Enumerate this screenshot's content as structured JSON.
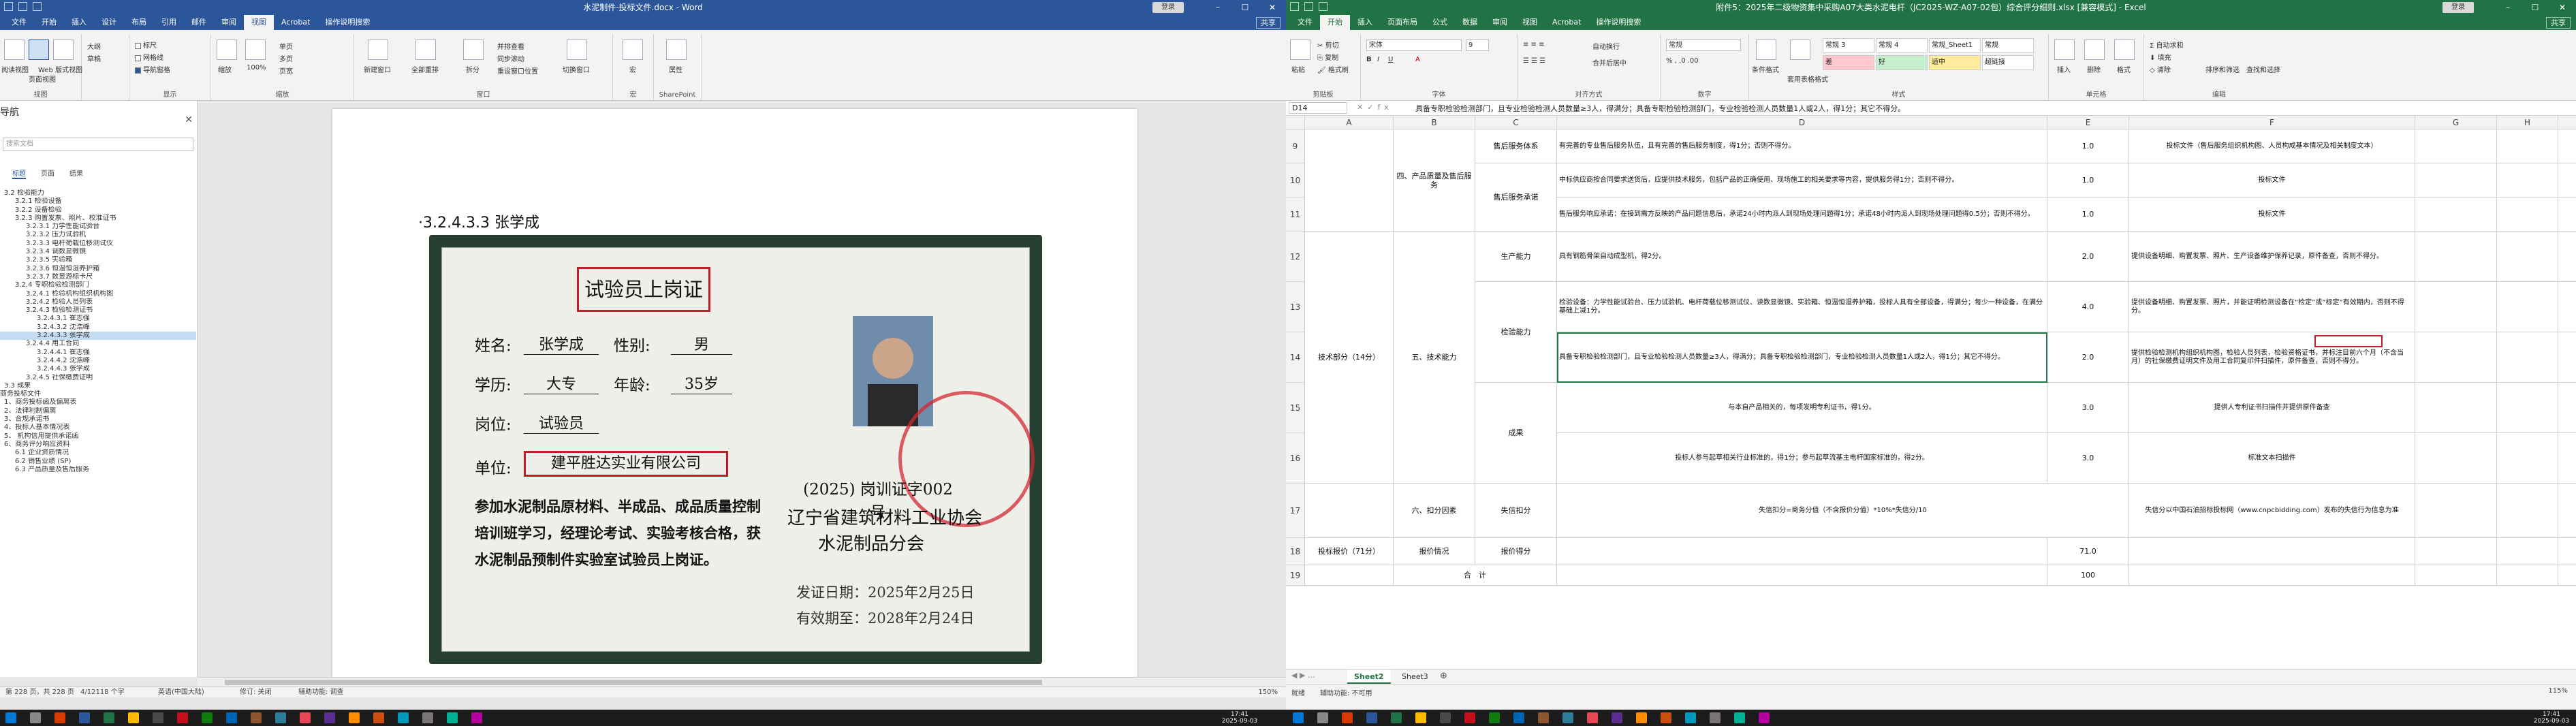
{
  "word": {
    "title": "水泥制件-投标文件.docx - Word",
    "signin": "登录",
    "tabs": [
      "文件",
      "开始",
      "插入",
      "设计",
      "布局",
      "引用",
      "邮件",
      "审阅",
      "视图",
      "Acrobat",
      "操作说明搜索"
    ],
    "share": "共享",
    "ribbon": {
      "views": {
        "read": "阅读视图",
        "print": "页面视图",
        "web": "Web 版式视图",
        "label": "视图"
      },
      "outline": "大纲",
      "draft": "草稿",
      "show": {
        "ruler": "标尺",
        "gridlines": "网格线",
        "navpane": "导航窗格",
        "label": "显示"
      },
      "zoom": {
        "zoom": "缩放",
        "pct": "100%",
        "onepage": "单页",
        "multipage": "多页",
        "pagewidth": "页宽",
        "label": "缩放"
      },
      "window": {
        "newwin": "新建窗口",
        "arrange": "全部重排",
        "split": "拆分",
        "side": "并排查看",
        "sync": "同步滚动",
        "reset": "重设窗口位置",
        "switch": "切换窗口",
        "label": "窗口"
      },
      "macro": {
        "macro": "宏",
        "label": "宏"
      },
      "sharepoint": {
        "props": "属性",
        "label": "SharePoint"
      }
    },
    "nav": {
      "title": "导航",
      "search_placeholder": "搜索文档",
      "tabs": [
        "标题",
        "页面",
        "结果"
      ],
      "items": [
        {
          "t": "3.2 检验能力",
          "l": 1
        },
        {
          "t": "3.2.1 检验设备",
          "l": 2
        },
        {
          "t": "3.2.2 设备检验",
          "l": 2
        },
        {
          "t": "3.2.3 购置发票、照片、校准证书",
          "l": 2
        },
        {
          "t": "3.2.3.1 力学性能试验台",
          "l": 3
        },
        {
          "t": "3.2.3.2 压力试验机",
          "l": 3
        },
        {
          "t": "3.2.3.3 电杆荷载位移测试仪",
          "l": 3
        },
        {
          "t": "3.2.3.4 调数显微镜",
          "l": 3
        },
        {
          "t": "3.2.3.5 实验箱",
          "l": 3
        },
        {
          "t": "3.2.3.6 恒温恒湿养护箱",
          "l": 3
        },
        {
          "t": "3.2.3.7 数显游标卡尺",
          "l": 3
        },
        {
          "t": "3.2.4 专职检验检测部门",
          "l": 2
        },
        {
          "t": "3.2.4.1 检验机构组织机构图",
          "l": 3
        },
        {
          "t": "3.2.4.2 检验人员列表",
          "l": 3
        },
        {
          "t": "3.2.4.3 检验检测证书",
          "l": 3
        },
        {
          "t": "3.2.4.3.1 崔志强",
          "l": 4
        },
        {
          "t": "3.2.4.3.2 沈浩峰",
          "l": 4
        },
        {
          "t": "3.2.4.3.3 张学成",
          "l": 4,
          "active": true
        },
        {
          "t": "3.2.4.4 用工合同",
          "l": 3
        },
        {
          "t": "3.2.4.4.1 崔志强",
          "l": 4
        },
        {
          "t": "3.2.4.4.2 沈浩峰",
          "l": 4
        },
        {
          "t": "3.2.4.4.3 张学成",
          "l": 4
        },
        {
          "t": "3.2.4.5 社保缴费证明",
          "l": 3
        },
        {
          "t": "3.3 成果",
          "l": 1
        },
        {
          "t": "商务投标文件",
          "l": 0
        },
        {
          "t": "1、商务投标函及偏离表",
          "l": 1
        },
        {
          "t": "2、法律利制偏离",
          "l": 1
        },
        {
          "t": "3、合规承诺书",
          "l": 1
        },
        {
          "t": "4、投标人基本情况表",
          "l": 1
        },
        {
          "t": "5、 机构信用提供承诺函",
          "l": 1
        },
        {
          "t": "6、商务评分响应资料",
          "l": 1
        },
        {
          "t": "6.1 企业资质情况",
          "l": 2
        },
        {
          "t": "6.2 销售业绩 (SP)",
          "l": 2
        },
        {
          "t": "6.3 产品质量及售后服务",
          "l": 2
        }
      ]
    },
    "doc": {
      "heading": "·3.2.4.3.3 张学成",
      "cert": {
        "title": "试验员上岗证",
        "name_lbl": "姓名:",
        "name": "张学成",
        "sex_lbl": "性别:",
        "sex": "男",
        "edu_lbl": "学历:",
        "edu": "大专",
        "age_lbl": "年龄:",
        "age": "35岁",
        "post_lbl": "岗位:",
        "post": "试验员",
        "unit_lbl": "单位:",
        "unit": "建平胜达实业有限公司",
        "para": "参加水泥制品原材料、半成品、成品质量控制培训班学习，经理论考试、实验考核合格，获水泥制品预制件实验室试验员上岗证。",
        "certno": "(2025) 岗训证字002号",
        "issuer1": "辽宁省建筑材料工业协会",
        "issuer2": "水泥制品分会",
        "issue_date": "发证日期：2025年2月25日",
        "valid_date": "有效期至：2028年2月24日"
      }
    },
    "status": {
      "page": "第 228 页，共 228 页",
      "words": "4/12118 个字",
      "lang": "英语(中国大陆)",
      "track": "修订: 关闭",
      "access": "辅助功能: 调查",
      "zoom": "150%"
    }
  },
  "excel": {
    "title": "附件5：2025年二级物资集中采购A07大类水泥电杆（JC2025-WZ-A07-02包）综合评分细则.xlsx [兼容模式] - Excel",
    "signin": "登录",
    "tabs": [
      "文件",
      "开始",
      "插入",
      "页面布局",
      "公式",
      "数据",
      "审阅",
      "视图",
      "Acrobat",
      "操作说明搜索"
    ],
    "share": "共享",
    "ribbon": {
      "clipboard": "剪贴板",
      "paste": "粘贴",
      "cut": "剪切",
      "copy": "复制",
      "painter": "格式刷",
      "font_name": "宋体",
      "font_size": "9",
      "font": "字体",
      "align": "对齐方式",
      "wrap": "自动换行",
      "merge": "合并后居中",
      "number": "数字",
      "numfmt": "常规",
      "cond": "条件格式",
      "table": "套用表格格式",
      "styles": [
        {
          "t": "常规 3",
          "bg": "#ffffff"
        },
        {
          "t": "常规 4",
          "bg": "#ffffff"
        },
        {
          "t": "常规_Sheet1",
          "bg": "#ffffff"
        },
        {
          "t": "常规",
          "bg": "#ffffff"
        },
        {
          "t": "差",
          "bg": "#ffc7ce"
        },
        {
          "t": "好",
          "bg": "#c6efce"
        },
        {
          "t": "适中",
          "bg": "#ffeb9c"
        },
        {
          "t": "超链接",
          "bg": "#ffffff"
        }
      ],
      "styles_lbl": "样式",
      "cells": "单元格",
      "insert": "插入",
      "delete": "删除",
      "format": "格式",
      "editing": "编辑",
      "autosum": "自动求和",
      "fill": "填充",
      "clear": "清除",
      "sortfilter": "排序和筛选",
      "findsel": "查找和选择"
    },
    "namebox": "D14",
    "formula": "具备专职检验检测部门，且专业检验检测人员数量≥3人，得满分；具备专职检验检测部门，专业检验检测人员数量1人或2人，得1分；其它不得分。",
    "cols": [
      "A",
      "B",
      "C",
      "D",
      "E",
      "F",
      "G",
      "H",
      "I",
      "J"
    ],
    "rows": {
      "r9": {
        "c": "售后服务体系",
        "d": "有完善的专业售后服务队伍，且有完善的售后服务制度，得1分；否则不得分。",
        "e": "1.0",
        "f": "投标文件（售后服务组织机构图、人员构成基本情况及相关制度文本）"
      },
      "r10": {
        "c": "售后服务承诺",
        "d": "中标供应商按合同要求送货后，应提供技术服务，包括产品的正确使用、现场施工的相关要求等内容，提供服务得1分；否则不得分。",
        "e": "1.0",
        "f": "投标文件"
      },
      "r11": {
        "d": "售后服务响应承诺：在接到需方反映的产品问题信息后，承诺24小时内派人到现场处理问题得1分；承诺48小时内派人到现场处理问题得0.5分；否则不得分。",
        "e": "1.0",
        "f": "投标文件"
      },
      "b9": "四、产品质量及售后服务",
      "r12": {
        "c": "生产能力",
        "d": "具有钢筋骨架自动成型机，得2分。",
        "e": "2.0",
        "f": "提供设备明细、购置发票、照片、生产设备维护保养记录，原件备查，否则不得分。"
      },
      "r13": {
        "d": "检验设备：力学性能试验台、压力试验机、电杆荷载位移测试仪、读数显微镜、实验箱、恒温恒湿养护箱，投标人具有全部设备，得满分；每少一种设备，在满分基础上减1分。",
        "e": "4.0",
        "f": "提供设备明细、购置发票、照片，并能证明检测设备在“检定”或“标定”有效期内，否则不得分。"
      },
      "r14": {
        "d": "具备专职检验检测部门，且专业检验检测人员数量≥3人，得满分；具备专职检验检测部门，专业检验检测人员数量1人或2人，得1分；其它不得分。",
        "e": "2.0",
        "f": "提供检验检测机构组织机构图，检验人员列表，检验资格证书，并标注目前六个月（不含当月）的社保缴费证明文件及用工合同复印件扫描件，原件备查，否则不得分。"
      },
      "c1314": "检验能力",
      "r15": {
        "d": "与本自产品相关的，每项发明专利证书，得1分。",
        "e": "3.0",
        "f": "提供人专利证书扫描件并提供原件备查"
      },
      "r16": {
        "d": "投标人参与起草相关行业标准的，得1分；参与起草流基主电杆国家标准的，得2分。",
        "e": "3.0",
        "f": "标准文本扫描件"
      },
      "c1516": "成果",
      "b1216": "五、技术能力",
      "a": "技术部分（14分）",
      "r17": {
        "b": "六、扣分因素",
        "c": "失信扣分",
        "d": "失信扣分=商务分值（不含报价分值）*10%*失信分/10",
        "f": "失信分以中国石油招标投标网（www.cnpcbidding.com）发布的失信行为信息为准"
      },
      "r18": {
        "a": "投标报价（71分）",
        "b": "报价情况",
        "c": "报价得分",
        "e": "71.0"
      },
      "r19": {
        "b": "合　计",
        "e": "100"
      }
    },
    "sheets": [
      "Sheet2",
      "Sheet3"
    ],
    "status": {
      "ready": "就绪",
      "access": "辅助功能: 不可用",
      "zoom": "115%"
    }
  },
  "taskbar": {
    "time": "17:41",
    "date": "2025-09-03"
  }
}
